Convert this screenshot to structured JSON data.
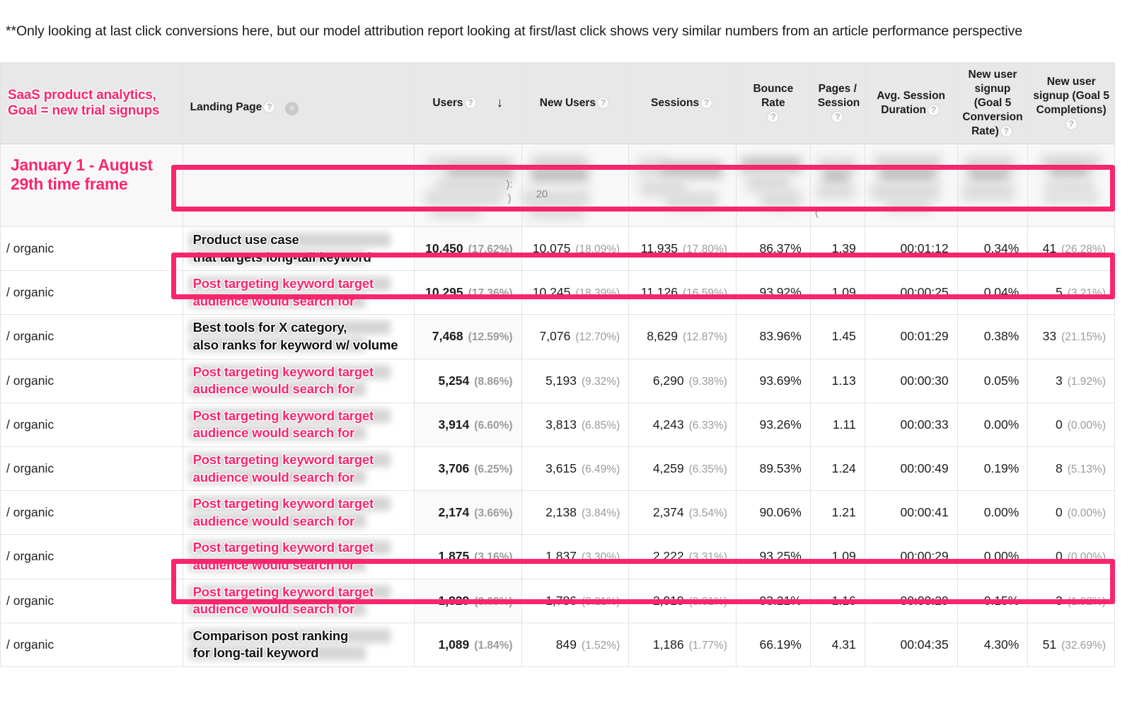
{
  "note": "**Only looking at last click conversions here, but our model attribution report looking at first/last click shows very similar numbers from an article performance perspective",
  "annotations": {
    "header_note_line1": "SaaS product analytics,",
    "header_note_line2": "Goal = new trial signups",
    "timeframe": "January 1 - August 29th time frame"
  },
  "colors": {
    "accent_pink": "#f9256e",
    "header_bg": "#e8e8e8",
    "summary_bg": "#f8f8f8",
    "muted_text": "#9b9b9b"
  },
  "icons": {
    "help": "?",
    "close": "×",
    "sort_desc": "↓"
  },
  "columns": [
    {
      "key": "source",
      "label": "",
      "align": "left"
    },
    {
      "key": "landing",
      "label": "Landing Page",
      "align": "left"
    },
    {
      "key": "users",
      "label": "Users",
      "align": "center"
    },
    {
      "key": "new_users",
      "label": "New Users",
      "align": "center"
    },
    {
      "key": "sessions",
      "label": "Sessions",
      "align": "center"
    },
    {
      "key": "bounce",
      "label": "Bounce Rate",
      "align": "center"
    },
    {
      "key": "pages",
      "label": "Pages / Session",
      "align": "center"
    },
    {
      "key": "duration",
      "label": "Avg. Session Duration",
      "align": "center"
    },
    {
      "key": "goal_rate",
      "label": "New user signup (Goal 5 Conversion Rate)",
      "align": "center"
    },
    {
      "key": "goal_comp",
      "label": "New user signup (Goal 5 Completions)",
      "align": "center"
    }
  ],
  "header_parts": {
    "users": "Users",
    "new_users": "New Users",
    "sessions": "Sessions",
    "bounce_rate": "Bounce Rate",
    "pages_session_l1": "Pages /",
    "pages_session_l2": "Session",
    "avg_session_l1": "Avg. Session",
    "avg_session_l2": "Duration",
    "goal_rate_l1": "New user",
    "goal_rate_l2": "signup",
    "goal_rate_l3": "(Goal 5",
    "goal_rate_l4": "Conversion",
    "goal_rate_l5": "Rate)",
    "goal_comp_l1": "New user",
    "goal_comp_l2": "signup (Goal 5",
    "goal_comp_l3": "Completions)"
  },
  "summary_row": {
    "label": "January 1 - August 29th time frame",
    "new_users_visible_fragment": "20",
    "users_visible_fragment_1": "):",
    "users_visible_fragment_2": ")",
    "redacted": true
  },
  "rows": [
    {
      "source": "/ organic",
      "landing_style": "dark",
      "landing_line1": "Product use case",
      "landing_line2": "that targets long-tail keyword",
      "users": "10,450",
      "users_pct": "(17.62%)",
      "new_users": "10,075",
      "new_users_pct": "(18.09%)",
      "sessions": "11,935",
      "sessions_pct": "(17.80%)",
      "bounce": "86.37%",
      "pages": "1.39",
      "duration": "00:01:12",
      "goal_rate": "0.34%",
      "goal_comp": "41",
      "goal_comp_pct": "(26.28%)",
      "highlighted": true
    },
    {
      "source": "/ organic",
      "landing_style": "pink",
      "landing_line1": "Post targeting keyword target",
      "landing_line2": "audience would search for",
      "users": "10,295",
      "users_pct": "(17.36%)",
      "new_users": "10,245",
      "new_users_pct": "(18.39%)",
      "sessions": "11,126",
      "sessions_pct": "(16.59%)",
      "bounce": "93.92%",
      "pages": "1.09",
      "duration": "00:00:25",
      "goal_rate": "0.04%",
      "goal_comp": "5",
      "goal_comp_pct": "(3.21%)",
      "highlighted": false
    },
    {
      "source": "/ organic",
      "landing_style": "dark",
      "landing_line1": "Best tools for X category,",
      "landing_line2": "also ranks for keyword w/ volume",
      "users": "7,468",
      "users_pct": "(12.59%)",
      "new_users": "7,076",
      "new_users_pct": "(12.70%)",
      "sessions": "8,629",
      "sessions_pct": "(12.87%)",
      "bounce": "83.96%",
      "pages": "1.45",
      "duration": "00:01:29",
      "goal_rate": "0.38%",
      "goal_comp": "33",
      "goal_comp_pct": "(21.15%)",
      "highlighted": true
    },
    {
      "source": "/ organic",
      "landing_style": "pink",
      "landing_line1": "Post targeting keyword target",
      "landing_line2": "audience would search for",
      "users": "5,254",
      "users_pct": "(8.86%)",
      "new_users": "5,193",
      "new_users_pct": "(9.32%)",
      "sessions": "6,290",
      "sessions_pct": "(9.38%)",
      "bounce": "93.69%",
      "pages": "1.13",
      "duration": "00:00:30",
      "goal_rate": "0.05%",
      "goal_comp": "3",
      "goal_comp_pct": "(1.92%)",
      "highlighted": false
    },
    {
      "source": "/ organic",
      "landing_style": "pink",
      "landing_line1": "Post targeting keyword target",
      "landing_line2": "audience would search for",
      "users": "3,914",
      "users_pct": "(6.60%)",
      "new_users": "3,813",
      "new_users_pct": "(6.85%)",
      "sessions": "4,243",
      "sessions_pct": "(6.33%)",
      "bounce": "93.26%",
      "pages": "1.11",
      "duration": "00:00:33",
      "goal_rate": "0.00%",
      "goal_comp": "0",
      "goal_comp_pct": "(0.00%)",
      "highlighted": false
    },
    {
      "source": "/ organic",
      "landing_style": "pink",
      "landing_line1": "Post targeting keyword target",
      "landing_line2": "audience would search for",
      "users": "3,706",
      "users_pct": "(6.25%)",
      "new_users": "3,615",
      "new_users_pct": "(6.49%)",
      "sessions": "4,259",
      "sessions_pct": "(6.35%)",
      "bounce": "89.53%",
      "pages": "1.24",
      "duration": "00:00:49",
      "goal_rate": "0.19%",
      "goal_comp": "8",
      "goal_comp_pct": "(5.13%)",
      "highlighted": false
    },
    {
      "source": "/ organic",
      "landing_style": "pink",
      "landing_line1": "Post targeting keyword target",
      "landing_line2": "audience would search for",
      "users": "2,174",
      "users_pct": "(3.66%)",
      "new_users": "2,138",
      "new_users_pct": "(3.84%)",
      "sessions": "2,374",
      "sessions_pct": "(3.54%)",
      "bounce": "90.06%",
      "pages": "1.21",
      "duration": "00:00:41",
      "goal_rate": "0.00%",
      "goal_comp": "0",
      "goal_comp_pct": "(0.00%)",
      "highlighted": false
    },
    {
      "source": "/ organic",
      "landing_style": "pink",
      "landing_line1": "Post targeting keyword target",
      "landing_line2": "audience would search for",
      "users": "1,875",
      "users_pct": "(3.16%)",
      "new_users": "1,837",
      "new_users_pct": "(3.30%)",
      "sessions": "2,222",
      "sessions_pct": "(3.31%)",
      "bounce": "93.25%",
      "pages": "1.09",
      "duration": "00:00:29",
      "goal_rate": "0.00%",
      "goal_comp": "0",
      "goal_comp_pct": "(0.00%)",
      "highlighted": false
    },
    {
      "source": "/ organic",
      "landing_style": "pink",
      "landing_line1": "Post targeting keyword target",
      "landing_line2": "audience would search for",
      "users": "1,829",
      "users_pct": "(3.08%)",
      "new_users": "1,786",
      "new_users_pct": "(3.21%)",
      "sessions": "2,019",
      "sessions_pct": "(3.01%)",
      "bounce": "93.21%",
      "pages": "1.16",
      "duration": "00:00:29",
      "goal_rate": "0.15%",
      "goal_comp": "3",
      "goal_comp_pct": "(1.92%)",
      "highlighted": false
    },
    {
      "source": "/ organic",
      "landing_style": "dark",
      "landing_line1": "Comparison post ranking",
      "landing_line2": "for long-tail keyword",
      "users": "1,089",
      "users_pct": "(1.84%)",
      "new_users": "849",
      "new_users_pct": "(1.52%)",
      "sessions": "1,186",
      "sessions_pct": "(1.77%)",
      "bounce": "66.19%",
      "pages": "4.31",
      "duration": "00:04:35",
      "goal_rate": "4.30%",
      "goal_comp": "51",
      "goal_comp_pct": "(32.69%)",
      "highlighted": true
    }
  ]
}
